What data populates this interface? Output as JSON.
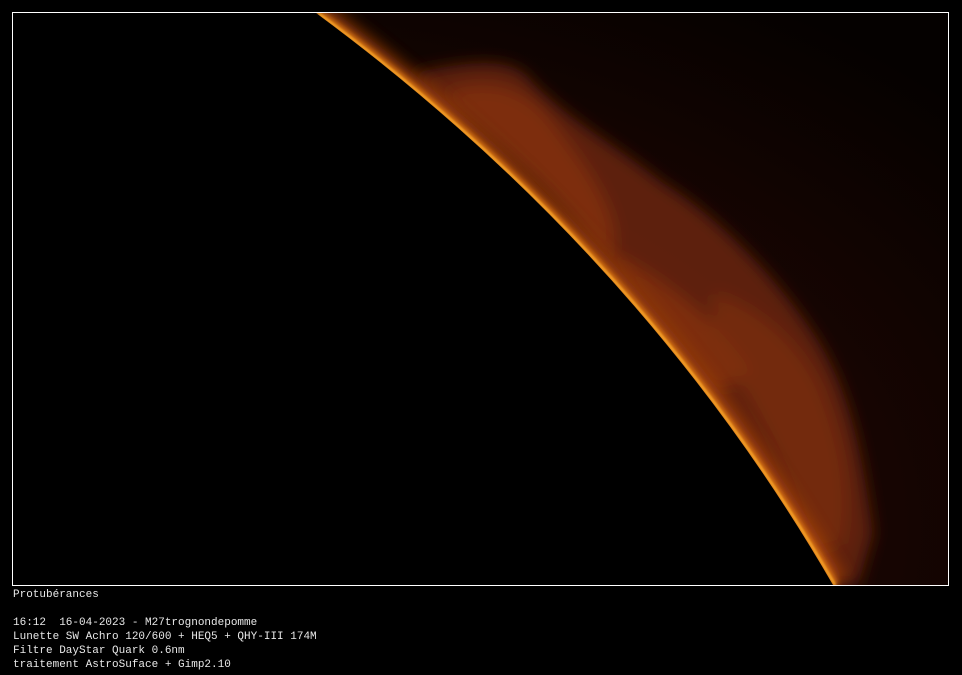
{
  "photo": {
    "subject": "solar-limb-prominences",
    "colors": {
      "limb": "#ffa21a",
      "glow": "#c2500c",
      "prominence": "#7a2e0c",
      "background": "#000000",
      "frame": "#ffffff"
    }
  },
  "caption": {
    "title": "Protubérances",
    "line1": "16:12  16-04-2023 - M27trognondepomme",
    "line2": "Lunette SW Achro 120/600 + HEQ5 + QHY-III 174M",
    "line3": "Filtre DayStar Quark 0.6nm",
    "line4": "traitement AstroSuface + Gimp2.10"
  }
}
